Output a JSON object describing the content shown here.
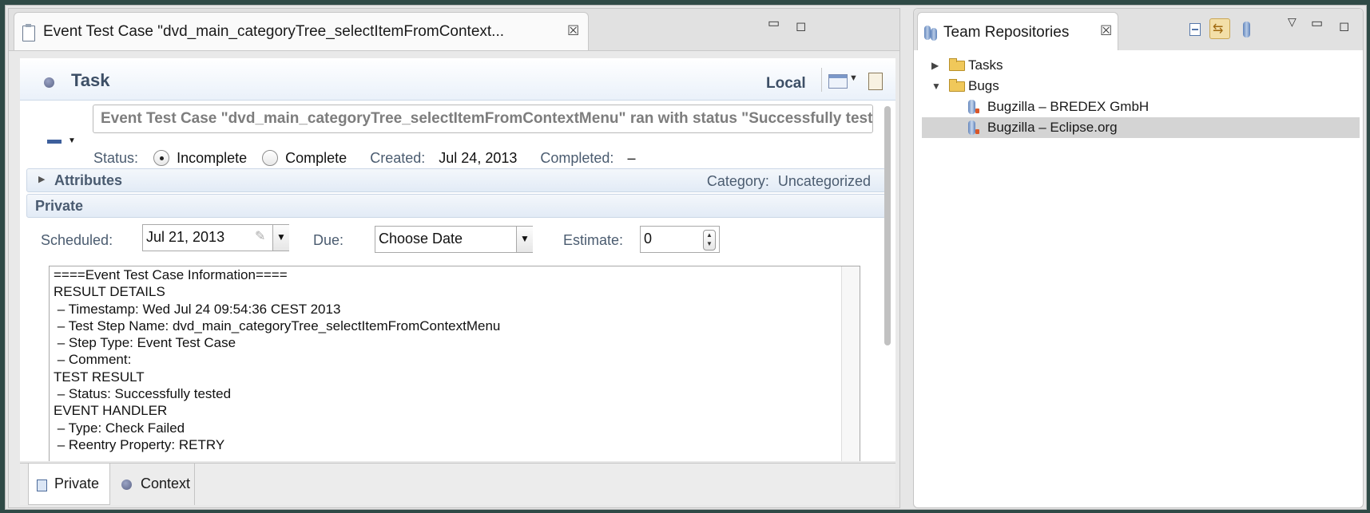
{
  "editor": {
    "tab_title": "Event Test Case \"dvd_main_categoryTree_selectItemFromContext...",
    "close_glyph": "☒",
    "minimize_glyph": "▭",
    "maximize_glyph": "◻",
    "header": {
      "title": "Task",
      "local_label": "Local"
    },
    "summary": "Event Test Case \"dvd_main_categoryTree_selectItemFromContextMenu\" ran with status \"Successfully tested\"",
    "status": {
      "label": "Status:",
      "option_incomplete": "Incomplete",
      "option_complete": "Complete",
      "selected": "Incomplete",
      "created_label": "Created:",
      "created_value": "Jul 24, 2013",
      "completed_label": "Completed:",
      "completed_value": "–"
    },
    "attributes": {
      "title": "Attributes",
      "category_label": "Category:",
      "category_value": "Uncategorized"
    },
    "private": {
      "title": "Private",
      "scheduled_label": "Scheduled:",
      "scheduled_value": "Jul 21, 2013",
      "due_label": "Due:",
      "due_value": "Choose Date",
      "estimate_label": "Estimate:",
      "estimate_value": "0"
    },
    "description_lines": [
      "====Event Test Case Information====",
      "RESULT DETAILS",
      " – Timestamp: Wed Jul 24 09:54:36 CEST 2013",
      " – Test Step Name: dvd_main_categoryTree_selectItemFromContextMenu",
      " – Step Type: Event Test Case",
      " – Comment:",
      "TEST RESULT",
      " – Status: Successfully tested",
      "EVENT HANDLER",
      " – Type: Check Failed",
      " – Reentry Property: RETRY"
    ],
    "bottom_tabs": {
      "private": "Private",
      "context": "Context"
    }
  },
  "repositories": {
    "tab_title": "Team Repositories",
    "close_glyph": "☒",
    "menu_glyph": "▽",
    "minimize_glyph": "▭",
    "maximize_glyph": "◻",
    "link_glyph": "⇆",
    "tree": [
      {
        "label": "Tasks",
        "expanded": false
      },
      {
        "label": "Bugs",
        "expanded": true
      },
      {
        "label": "Bugzilla – BREDEX GmbH"
      },
      {
        "label": "Bugzilla – Eclipse.org",
        "selected": true
      }
    ]
  }
}
